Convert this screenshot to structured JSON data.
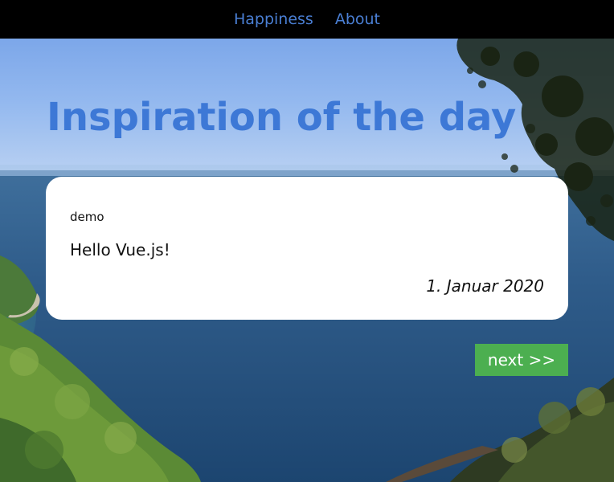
{
  "nav": {
    "links": [
      "Happiness",
      "About"
    ]
  },
  "headline": "Inspiration of the day",
  "card": {
    "tag": "demo",
    "text": "Hello Vue.js!",
    "date": "1. Januar 2020"
  },
  "next_button_label": "next >>",
  "colors": {
    "nav_bg": "#000000",
    "nav_link": "#4a7fd4",
    "headline": "#3d78d6",
    "card_bg": "#ffffff",
    "button_bg": "#4caf50",
    "button_text": "#ffffff"
  }
}
